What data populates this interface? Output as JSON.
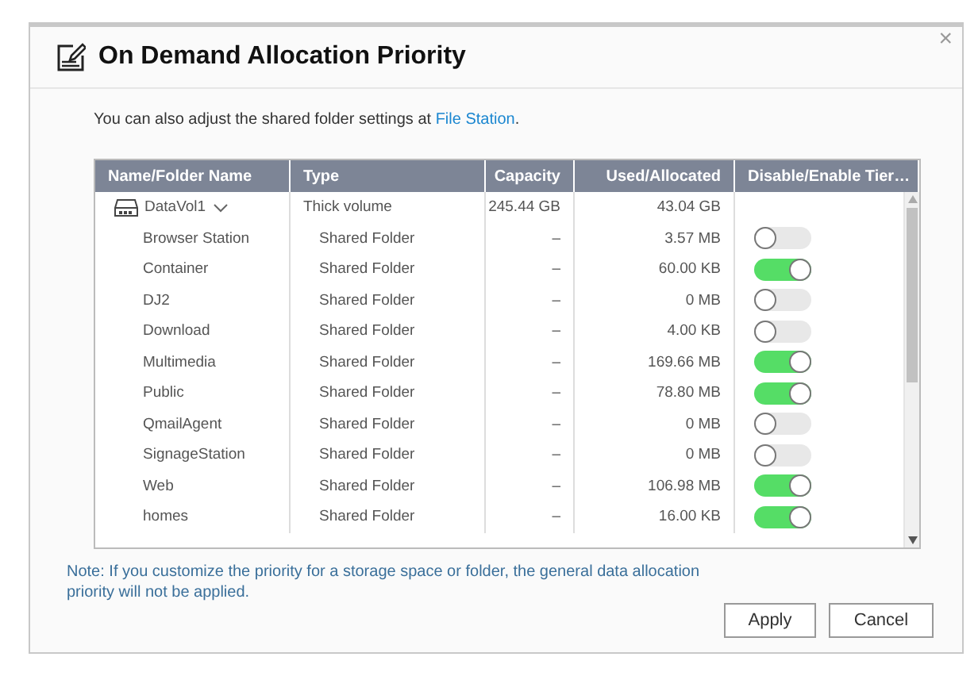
{
  "dialog": {
    "title": "On Demand Allocation Priority",
    "close": "×"
  },
  "intro": {
    "text": "You can also adjust the shared folder settings at ",
    "link": "File Station",
    "end": "."
  },
  "table": {
    "columns": [
      "Name/Folder Name",
      "Type",
      "Capacity",
      "Used/Allocated",
      "Disable/Enable Tier…"
    ],
    "rows": [
      {
        "name": "DataVol1",
        "type": "Thick volume",
        "capacity": "245.44 GB",
        "used": "43.04 GB",
        "expanded": true,
        "children": [
          {
            "name": "Browser Station",
            "type": "Shared Folder",
            "capacity": "–",
            "used": "3.57 MB",
            "on": false
          },
          {
            "name": "Container",
            "type": "Shared Folder",
            "capacity": "–",
            "used": "60.00 KB",
            "on": true
          },
          {
            "name": "DJ2",
            "type": "Shared Folder",
            "capacity": "–",
            "used": "0 MB",
            "on": false
          },
          {
            "name": "Download",
            "type": "Shared Folder",
            "capacity": "–",
            "used": "4.00 KB",
            "on": false
          },
          {
            "name": "Multimedia",
            "type": "Shared Folder",
            "capacity": "–",
            "used": "169.66 MB",
            "on": true
          },
          {
            "name": "Public",
            "type": "Shared Folder",
            "capacity": "–",
            "used": "78.80 MB",
            "on": true
          },
          {
            "name": "QmailAgent",
            "type": "Shared Folder",
            "capacity": "–",
            "used": "0 MB",
            "on": false
          },
          {
            "name": "SignageStation",
            "type": "Shared Folder",
            "capacity": "–",
            "used": "0 MB",
            "on": false
          },
          {
            "name": "Web",
            "type": "Shared Folder",
            "capacity": "–",
            "used": "106.98 MB",
            "on": true
          },
          {
            "name": "homes",
            "type": "Shared Folder",
            "capacity": "–",
            "used": "16.00 KB",
            "on": true
          }
        ]
      }
    ]
  },
  "note": "Note: If you customize the priority for a storage space or folder, the general data allocation priority will not be applied.",
  "buttons": [
    "Apply",
    "Cancel"
  ]
}
